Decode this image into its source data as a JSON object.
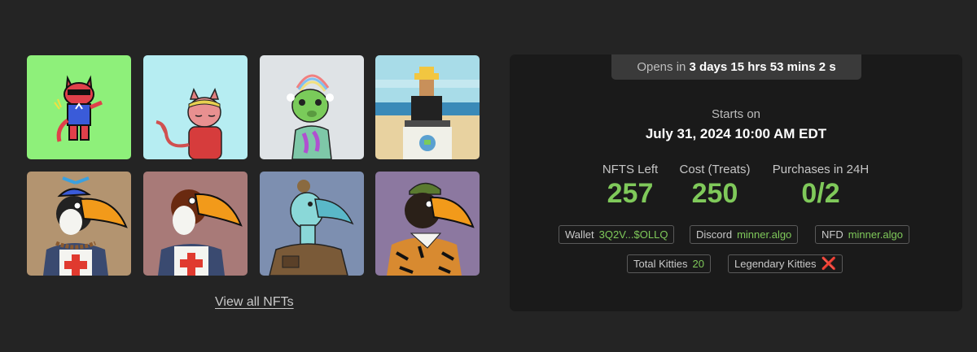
{
  "gallery": {
    "tiles": [
      {
        "name": "nft-red-cat",
        "bg": "#8ef07a"
      },
      {
        "name": "nft-pink-cat",
        "bg": "#b6edf2"
      },
      {
        "name": "nft-green-alien",
        "bg": "#dfe3e6"
      },
      {
        "name": "nft-pixel-beach",
        "bg": "#8fd3d8"
      },
      {
        "name": "nft-toucan-propeller",
        "bg": "#b39470"
      },
      {
        "name": "nft-toucan-nurse",
        "bg": "#a87a78"
      },
      {
        "name": "nft-cyan-bird",
        "bg": "#7d8fb0"
      },
      {
        "name": "nft-tiger-toucan",
        "bg": "#8c78a0"
      }
    ],
    "view_all_label": "View all NFTs"
  },
  "panel": {
    "opens_prefix": "Opens in",
    "opens_countdown": "3 days 15 hrs 53 mins 2 s",
    "starts_label": "Starts on",
    "starts_date": "July 31, 2024 10:00 AM EDT",
    "stats": [
      {
        "label": "NFTS Left",
        "value": "257"
      },
      {
        "label": "Cost (Treats)",
        "value": "250"
      },
      {
        "label": "Purchases in 24H",
        "value": "0/2"
      }
    ],
    "chips": {
      "wallet_label": "Wallet",
      "wallet_value": "3Q2V...$OLLQ",
      "discord_label": "Discord",
      "discord_value": "minner.algo",
      "nfd_label": "NFD",
      "nfd_value": "minner.algo",
      "kitties_label": "Total Kitties",
      "kitties_value": "20",
      "legendary_label": "Legendary Kitties",
      "legendary_value": "❌"
    },
    "accent": "#7fc95a"
  }
}
